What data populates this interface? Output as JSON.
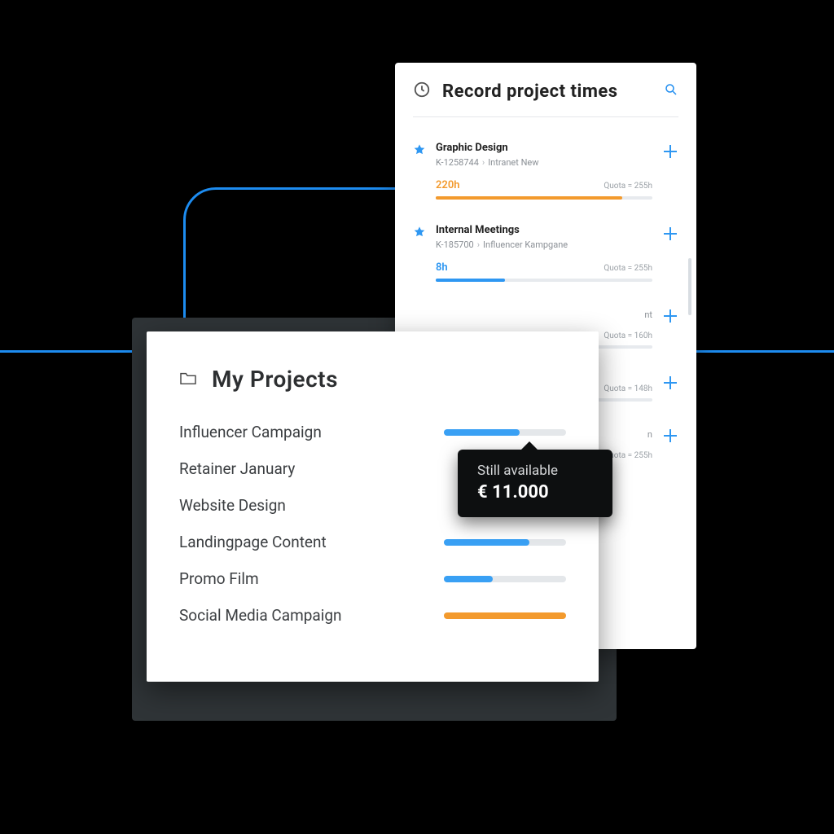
{
  "record": {
    "title": "Record project times",
    "items": [
      {
        "name": "Graphic Design",
        "code": "K-1258744",
        "project": "Intranet New",
        "hours": "220h",
        "quota": "Quota = 255h",
        "fill_pct": 86,
        "color": "orange",
        "starred": true
      },
      {
        "name": "Internal Meetings",
        "code": "K-185700",
        "project": "Influencer Kampgane",
        "hours": "8h",
        "quota": "Quota = 255h",
        "fill_pct": 32,
        "color": "blue",
        "starred": true
      },
      {
        "name_fragment": "nt",
        "quota": "Quota = 160h",
        "fill_pct": 55,
        "color": "orange"
      },
      {
        "quota": "Quota = 148h",
        "fill_pct": 70,
        "color": "blue"
      },
      {
        "name_fragment": "n",
        "quota": "Quota = 255h"
      }
    ]
  },
  "projects": {
    "title": "My Projects",
    "rows": [
      {
        "label": "Influencer Campaign",
        "pct": 62,
        "color": "blue"
      },
      {
        "label": "Retainer January",
        "pct": 0,
        "color": "none"
      },
      {
        "label": "Website Design",
        "pct": 0,
        "color": "none"
      },
      {
        "label": "Landingpage Content",
        "pct": 70,
        "color": "blue"
      },
      {
        "label": "Promo Film",
        "pct": 40,
        "color": "blue"
      },
      {
        "label": "Social Media Campaign",
        "pct": 100,
        "color": "orange"
      }
    ]
  },
  "tooltip": {
    "label": "Still available",
    "value": "€ 11.000"
  }
}
